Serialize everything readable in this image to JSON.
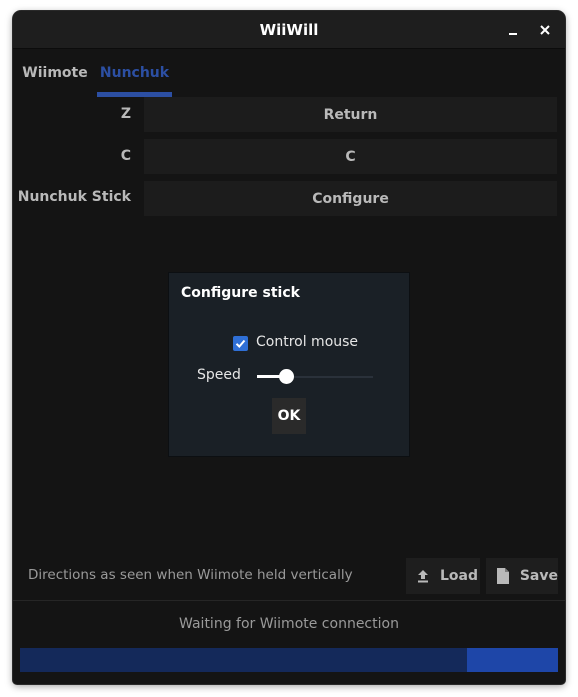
{
  "window": {
    "title": "WiiWill",
    "minimize_icon": "minimize-icon",
    "close_icon": "close-icon"
  },
  "tabs": [
    {
      "label": "Wiimote",
      "active": false
    },
    {
      "label": "Nunchuk",
      "active": true
    }
  ],
  "mappings": [
    {
      "label": "Z",
      "value": "Return"
    },
    {
      "label": "C",
      "value": "C"
    },
    {
      "label": "Nunchuk Stick",
      "value": "Configure"
    }
  ],
  "dialog": {
    "title": "Configure stick",
    "control_mouse": {
      "label": "Control mouse",
      "checked": true
    },
    "speed": {
      "label": "Speed",
      "value": 0.25
    },
    "ok_label": "OK"
  },
  "footer": {
    "hint": "Directions as seen when Wiimote held vertically",
    "load_label": "Load",
    "load_icon": "upload-icon",
    "save_label": "Save",
    "save_icon": "file-icon"
  },
  "status": {
    "text": "Waiting for Wiimote connection",
    "progress": 0.17
  },
  "colors": {
    "accent": "#2c4fa3",
    "checkbox": "#2f6fd6",
    "progress_track": "#14295a",
    "progress_fill": "#1e46a8"
  }
}
